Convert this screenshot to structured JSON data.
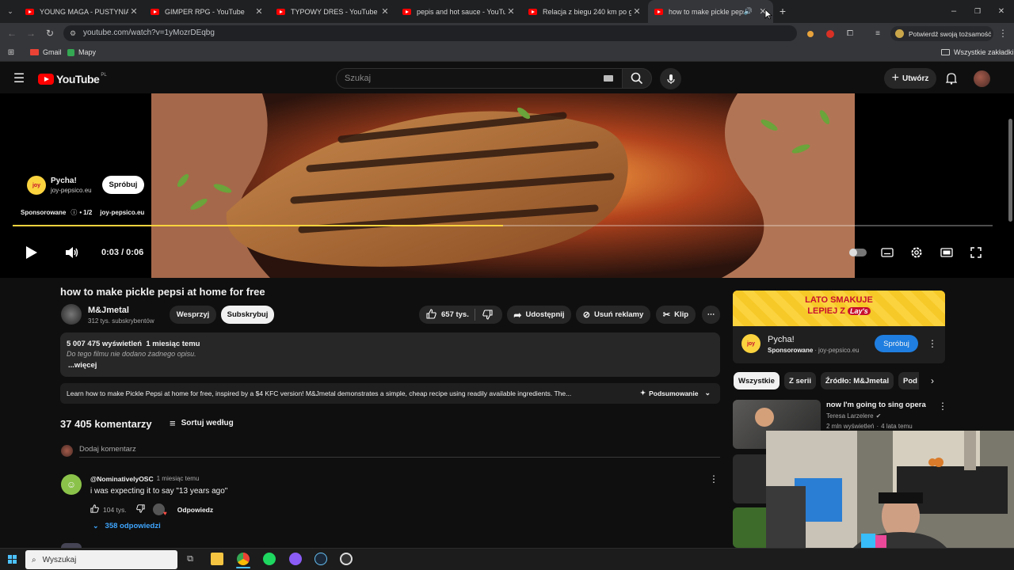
{
  "browser": {
    "tabs": [
      {
        "title": "YOUNG MAGA - PUSTYNIA [off"
      },
      {
        "title": "GIMPER RPG - YouTube"
      },
      {
        "title": "TYPOWY DRES - YouTube"
      },
      {
        "title": "pepis and hot sauce - YouTube"
      },
      {
        "title": "Relacja z biegu 240 km po góra"
      },
      {
        "title": "how to make pickle pepsi a"
      }
    ],
    "url": "youtube.com/watch?v=1yMozrDEqbg",
    "profile_text": "Potwierdź swoją tożsamość",
    "bookmarks": [
      "Gmail",
      "Mapy"
    ],
    "all_bookmarks": "Wszystkie zakładki"
  },
  "header": {
    "logo_text": "YouTube",
    "region": "PL",
    "search_placeholder": "Szukaj",
    "create_label": "Utwórz"
  },
  "player": {
    "ad_brand": "Pycha!",
    "ad_domain": "joy-pepsico.eu",
    "ad_cta": "Spróbuj",
    "ad_sponsored": "Sponsorowane",
    "ad_counter": "1/2",
    "ad_link": "joy-pepsico.eu",
    "time": "0:03 / 0:06",
    "progress": 0.5
  },
  "video": {
    "title": "how to make pickle pepsi at home for free",
    "channel": "M&Jmetal",
    "subs": "312 tys. subskrybentów",
    "support": "Wesprzyj",
    "subscribe": "Subskrybuj",
    "likes": "657 tys.",
    "share": "Udostępnij",
    "remove_ads": "Usuń reklamy",
    "clip": "Klip"
  },
  "description": {
    "views": "5 007 475 wyświetleń",
    "age": "1 miesiąc temu",
    "empty": "Do tego filmu nie dodano żadnego opisu.",
    "more": "...więcej",
    "summary": "Learn how to make Pickle Pepsi at home for free, inspired by a $4 KFC version! M&Jmetal demonstrates a simple, cheap recipe using readily available ingredients. The...",
    "summary_btn": "Podsumowanie"
  },
  "comments": {
    "count": "37 405 komentarzy",
    "sort": "Sortuj według",
    "add": "Dodaj komentarz",
    "items": [
      {
        "author": "@NominativelyOSC",
        "age": "1 miesiąc temu",
        "text": "i was expecting it to say \"13 years ago\"",
        "likes": "104 tys.",
        "reply": "Odpowiedz",
        "replies": "358 odpowiedzi"
      }
    ]
  },
  "sidebar": {
    "banner_line1": "LATO SMAKUJE",
    "banner_line2": "LEPIEJ Z",
    "banner_brand": "Lay's",
    "ad_name": "Pycha!",
    "ad_sponsored": "Sponsorowane",
    "ad_domain": "joy-pepsico.eu",
    "ad_cta": "Spróbuj",
    "chips": [
      "Wszystkie",
      "Z serii",
      "Źródło: M&Jmetal",
      "Pod"
    ],
    "rec_title": "now I'm going to sing opera",
    "rec_channel": "Teresa Larzelere",
    "rec_meta": "2 mln wyświetleń",
    "rec_age": "4 lata temu"
  },
  "taskbar": {
    "search": "Wyszukaj"
  },
  "colors": {
    "yt_red": "#ff0000",
    "ad_yellow": "#fbd33f",
    "link_blue": "#3ea6ff",
    "cta_blue": "#1f7ee0"
  }
}
